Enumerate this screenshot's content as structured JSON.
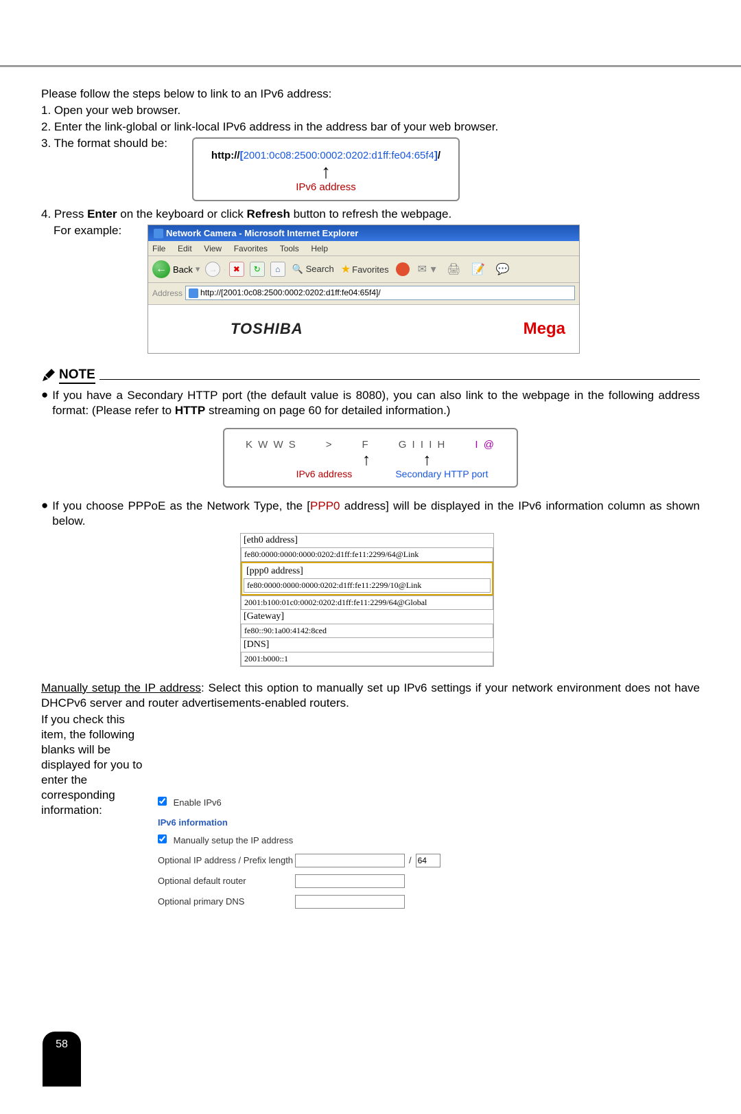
{
  "intro": {
    "text": "Please follow the steps below to link to an IPv6 address:",
    "step1": "1. Open your web browser.",
    "step2": "2. Enter the link-global or link-local IPv6 address in the address bar of your web browser.",
    "step3": "3. The format should be:"
  },
  "url_example": {
    "prefix": "http://",
    "open_bracket": "[",
    "address": "2001:0c08:2500:0002:0202:d1ff:fe04:65f4",
    "close_bracket": "]",
    "suffix": "/",
    "label": "IPv6 address"
  },
  "step4": {
    "text_prefix": "4. Press ",
    "enter": "Enter",
    "text_mid": " on the keyboard or click ",
    "refresh": "Refresh",
    "text_suffix": " button to refresh the webpage.",
    "for_example": "For example:"
  },
  "ie": {
    "title": "Network Camera - Microsoft Internet Explorer",
    "menu": [
      "File",
      "Edit",
      "View",
      "Favorites",
      "Tools",
      "Help"
    ],
    "back": "Back",
    "search": "Search",
    "favorites": "Favorites",
    "address_label": "Address",
    "address_value": "http://[2001:0c08:2500:0002:0202:d1ff:fe04:65f4]/",
    "toshiba": "TOSHIBA",
    "mega": "Mega"
  },
  "note": {
    "title": "NOTE",
    "bullet1_a": "If you have a Secondary HTTP port (the default value is 8080), you can also link to the webpage in the following address format: (Please refer to ",
    "bullet1_b": "HTTP",
    "bullet1_c": " streaming on page 60 for detailed information.)",
    "example": {
      "tokens": [
        "K W W S",
        ">",
        "F",
        "G  I I  I H",
        "I  @"
      ],
      "label_left": "IPv6 address",
      "label_right": "Secondary HTTP port"
    },
    "bullet2_a": "If you choose PPPoE as the Network Type, the [",
    "bullet2_ppp": "PPP0",
    "bullet2_b": " address] will be displayed in the IPv6 information column as shown below."
  },
  "ipv6_info": {
    "eth0_label": "[eth0 address]",
    "eth0_val": "fe80:0000:0000:0000:0202:d1ff:fe11:2299/64@Link",
    "ppp0_label": "[ppp0 address]",
    "ppp0_val1": "fe80:0000:0000:0000:0202:d1ff:fe11:2299/10@Link",
    "ppp0_val2": "2001:b100:01c0:0002:0202:d1ff:fe11:2299/64@Global",
    "gateway_label": "[Gateway]",
    "gateway_val": "fe80::90:1a00:4142:8ced",
    "dns_label": "[DNS]",
    "dns_val": "2001:b000::1"
  },
  "manual": {
    "text1_a": "Manually setup the IP address",
    "text1_b": ": Select this option to manually set up IPv6 settings if your network environment does not have DHCPv6 server and router advertisements-enabled routers.",
    "text2": "If you check this item, the following blanks will be displayed for you to enter the corresponding information:"
  },
  "form": {
    "enable_label": "Enable IPv6",
    "info_title": "IPv6 information",
    "manual_label": "Manually setup the IP address",
    "optional_ip": "Optional IP address / Prefix length",
    "prefix_value": "64",
    "optional_router": "Optional default router",
    "optional_dns": "Optional primary DNS"
  },
  "page_number": "58"
}
